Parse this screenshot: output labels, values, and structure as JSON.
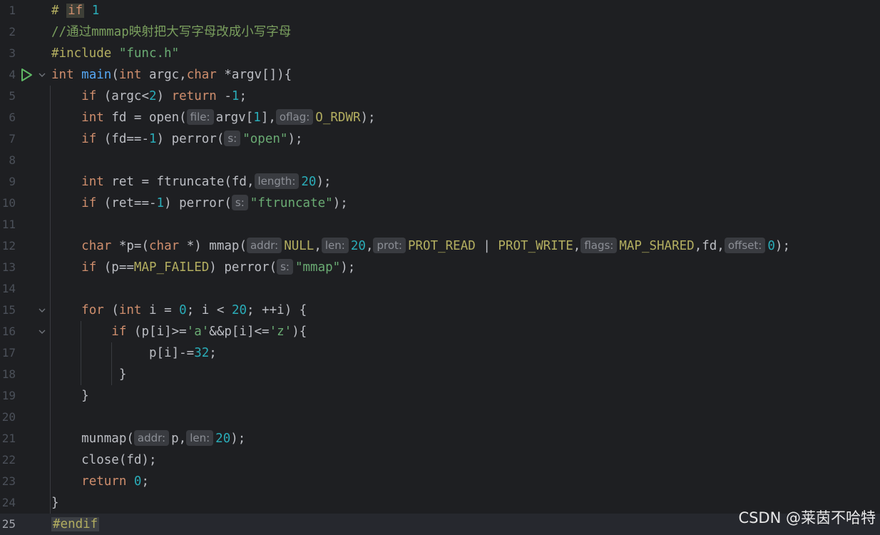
{
  "editor": {
    "current_line": 25,
    "lines": [
      {
        "n": "1",
        "tokens": [
          {
            "t": "# ",
            "c": "pp"
          },
          {
            "t": "if",
            "c": "ifbg"
          },
          {
            "t": " ",
            "c": ""
          },
          {
            "t": "1",
            "c": "num"
          }
        ]
      },
      {
        "n": "2",
        "tokens": [
          {
            "t": "//通过",
            "c": "cmt"
          },
          {
            "t": "mmmap",
            "c": "cmt squig"
          },
          {
            "t": "映射把大写字母改成小写字母",
            "c": "cmt"
          }
        ]
      },
      {
        "n": "3",
        "tokens": [
          {
            "t": "#include ",
            "c": "pp"
          },
          {
            "t": "\"func.h\"",
            "c": "str"
          }
        ]
      },
      {
        "n": "4",
        "tokens": [
          {
            "t": "int ",
            "c": "kw"
          },
          {
            "t": "main",
            "c": "fn"
          },
          {
            "t": "(",
            "c": ""
          },
          {
            "t": "int ",
            "c": "kw"
          },
          {
            "t": "argc,",
            "c": ""
          },
          {
            "t": "char ",
            "c": "kw"
          },
          {
            "t": "*argv[]){",
            "c": ""
          }
        ]
      },
      {
        "n": "5",
        "tokens": [
          {
            "t": "    ",
            "c": ""
          },
          {
            "t": "if ",
            "c": "kw"
          },
          {
            "t": "(argc<",
            "c": ""
          },
          {
            "t": "2",
            "c": "num"
          },
          {
            "t": ") ",
            "c": ""
          },
          {
            "t": "return ",
            "c": "kw"
          },
          {
            "t": "-",
            "c": ""
          },
          {
            "t": "1",
            "c": "num"
          },
          {
            "t": ";",
            "c": ""
          }
        ]
      },
      {
        "n": "6",
        "tokens": [
          {
            "t": "    ",
            "c": ""
          },
          {
            "t": "int ",
            "c": "kw"
          },
          {
            "t": "fd = open(",
            "c": ""
          },
          {
            "t": "file:",
            "c": "hint"
          },
          {
            "t": "argv[",
            "c": ""
          },
          {
            "t": "1",
            "c": "num"
          },
          {
            "t": "],",
            "c": ""
          },
          {
            "t": "oflag:",
            "c": "hint"
          },
          {
            "t": "O_RDWR",
            "c": "macro"
          },
          {
            "t": ");",
            "c": ""
          }
        ]
      },
      {
        "n": "7",
        "tokens": [
          {
            "t": "    ",
            "c": ""
          },
          {
            "t": "if ",
            "c": "kw"
          },
          {
            "t": "(fd==-",
            "c": ""
          },
          {
            "t": "1",
            "c": "num"
          },
          {
            "t": ") perror(",
            "c": ""
          },
          {
            "t": "s:",
            "c": "hint"
          },
          {
            "t": "\"open\"",
            "c": "str"
          },
          {
            "t": ");",
            "c": ""
          }
        ]
      },
      {
        "n": "8",
        "tokens": []
      },
      {
        "n": "9",
        "tokens": [
          {
            "t": "    ",
            "c": ""
          },
          {
            "t": "int ",
            "c": "kw"
          },
          {
            "t": "ret = ftruncate(fd,",
            "c": ""
          },
          {
            "t": "length:",
            "c": "hint"
          },
          {
            "t": "20",
            "c": "num"
          },
          {
            "t": ");",
            "c": ""
          }
        ]
      },
      {
        "n": "10",
        "tokens": [
          {
            "t": "    ",
            "c": ""
          },
          {
            "t": "if ",
            "c": "kw"
          },
          {
            "t": "(ret==-",
            "c": ""
          },
          {
            "t": "1",
            "c": "num"
          },
          {
            "t": ") perror(",
            "c": ""
          },
          {
            "t": "s:",
            "c": "hint"
          },
          {
            "t": "\"ftruncate\"",
            "c": "str"
          },
          {
            "t": ");",
            "c": ""
          }
        ]
      },
      {
        "n": "11",
        "tokens": []
      },
      {
        "n": "12",
        "tokens": [
          {
            "t": "    ",
            "c": ""
          },
          {
            "t": "char ",
            "c": "kw"
          },
          {
            "t": "*p=(",
            "c": ""
          },
          {
            "t": "char ",
            "c": "kw"
          },
          {
            "t": "*) mmap(",
            "c": ""
          },
          {
            "t": "addr:",
            "c": "hint"
          },
          {
            "t": "NULL",
            "c": "macro"
          },
          {
            "t": ",",
            "c": ""
          },
          {
            "t": "len:",
            "c": "hint"
          },
          {
            "t": "20",
            "c": "num"
          },
          {
            "t": ",",
            "c": ""
          },
          {
            "t": "prot:",
            "c": "hint"
          },
          {
            "t": "PROT_READ",
            "c": "macro"
          },
          {
            "t": " | ",
            "c": ""
          },
          {
            "t": "PROT_WRITE",
            "c": "macro"
          },
          {
            "t": ",",
            "c": ""
          },
          {
            "t": "flags:",
            "c": "hint"
          },
          {
            "t": "MAP_SHARED",
            "c": "macro"
          },
          {
            "t": ",fd,",
            "c": ""
          },
          {
            "t": "offset:",
            "c": "hint"
          },
          {
            "t": "0",
            "c": "num"
          },
          {
            "t": ");",
            "c": ""
          }
        ]
      },
      {
        "n": "13",
        "tokens": [
          {
            "t": "    ",
            "c": ""
          },
          {
            "t": "if ",
            "c": "kw"
          },
          {
            "t": "(p==",
            "c": ""
          },
          {
            "t": "MAP_FAILED",
            "c": "macro"
          },
          {
            "t": ") perror(",
            "c": ""
          },
          {
            "t": "s:",
            "c": "hint"
          },
          {
            "t": "\"mmap\"",
            "c": "str"
          },
          {
            "t": ");",
            "c": ""
          }
        ]
      },
      {
        "n": "14",
        "tokens": []
      },
      {
        "n": "15",
        "tokens": [
          {
            "t": "    ",
            "c": ""
          },
          {
            "t": "for ",
            "c": "kw"
          },
          {
            "t": "(",
            "c": ""
          },
          {
            "t": "int ",
            "c": "kw"
          },
          {
            "t": "i = ",
            "c": ""
          },
          {
            "t": "0",
            "c": "num"
          },
          {
            "t": "; i < ",
            "c": ""
          },
          {
            "t": "20",
            "c": "num"
          },
          {
            "t": "; ++i) {",
            "c": ""
          }
        ]
      },
      {
        "n": "16",
        "tokens": [
          {
            "t": "        ",
            "c": ""
          },
          {
            "t": "if ",
            "c": "kw"
          },
          {
            "t": "(p[i]>=",
            "c": ""
          },
          {
            "t": "'a'",
            "c": "str"
          },
          {
            "t": "&&p[i]<=",
            "c": ""
          },
          {
            "t": "'z'",
            "c": "str"
          },
          {
            "t": "){",
            "c": ""
          }
        ]
      },
      {
        "n": "17",
        "tokens": [
          {
            "t": "             p[i]-=",
            "c": ""
          },
          {
            "t": "32",
            "c": "num"
          },
          {
            "t": ";",
            "c": ""
          }
        ]
      },
      {
        "n": "18",
        "tokens": [
          {
            "t": "         }",
            "c": ""
          }
        ]
      },
      {
        "n": "19",
        "tokens": [
          {
            "t": "    }",
            "c": ""
          }
        ]
      },
      {
        "n": "20",
        "tokens": []
      },
      {
        "n": "21",
        "tokens": [
          {
            "t": "    munmap(",
            "c": ""
          },
          {
            "t": "addr:",
            "c": "hint"
          },
          {
            "t": "p,",
            "c": ""
          },
          {
            "t": "len:",
            "c": "hint"
          },
          {
            "t": "20",
            "c": "num"
          },
          {
            "t": ");",
            "c": ""
          }
        ]
      },
      {
        "n": "22",
        "tokens": [
          {
            "t": "    close(fd);",
            "c": ""
          }
        ]
      },
      {
        "n": "23",
        "tokens": [
          {
            "t": "    ",
            "c": ""
          },
          {
            "t": "return ",
            "c": "kw"
          },
          {
            "t": "0",
            "c": "num"
          },
          {
            "t": ";",
            "c": ""
          }
        ]
      },
      {
        "n": "24",
        "tokens": [
          {
            "t": "}",
            "c": ""
          }
        ]
      },
      {
        "n": "25",
        "tokens": [
          {
            "t": "#endif",
            "c": "ppbg"
          }
        ]
      }
    ]
  },
  "colors": {
    "background": "#1e1f22",
    "keyword": "#cf8e6d",
    "number": "#2aacb8",
    "string": "#6aab73",
    "function": "#56a8f5",
    "macro": "#b3ae60"
  },
  "icons": {
    "run": "run-icon",
    "fold": "fold-chevron-icon"
  },
  "watermark": "CSDN @莱茵不哈特"
}
